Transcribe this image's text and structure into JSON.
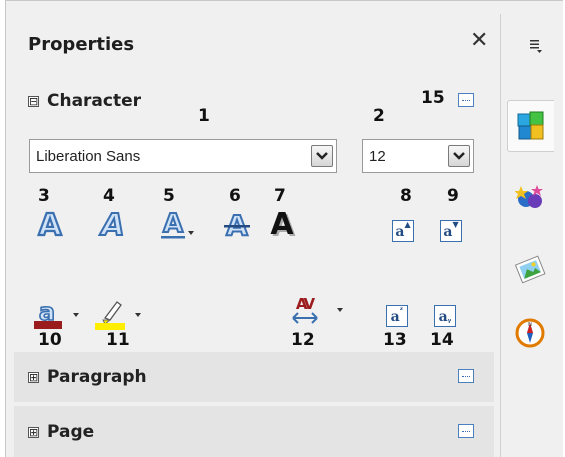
{
  "panel": {
    "title": "Properties"
  },
  "sidebar": {
    "menu_icon": "sidebar-menu-icon",
    "tabs": [
      {
        "name": "properties",
        "icon": "properties-icon"
      },
      {
        "name": "styles",
        "icon": "styles-icon"
      },
      {
        "name": "gallery",
        "icon": "gallery-icon"
      },
      {
        "name": "navigator",
        "icon": "navigator-icon"
      }
    ]
  },
  "sections": {
    "character": {
      "label": "Character",
      "expander": "⊟"
    },
    "paragraph": {
      "label": "Paragraph",
      "expander": "⊞"
    },
    "page": {
      "label": "Page",
      "expander": "⊞"
    }
  },
  "character": {
    "font_name": "Liberation Sans",
    "font_size": "12"
  },
  "callouts": [
    "1",
    "2",
    "3",
    "4",
    "5",
    "6",
    "7",
    "8",
    "9",
    "10",
    "11",
    "12",
    "13",
    "14",
    "15"
  ],
  "colors": {
    "accent": "#3a6fb0",
    "font_color": "#9b1c1c",
    "highlight": "#ffee00"
  }
}
